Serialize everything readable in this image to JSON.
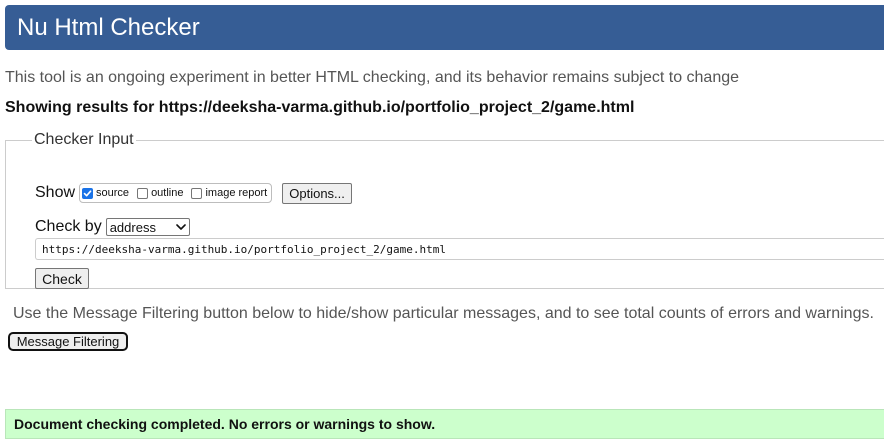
{
  "header": {
    "title": "Nu Html Checker"
  },
  "subtitle": "This tool is an ongoing experiment in better HTML checking, and its behavior remains subject to change",
  "results_heading": "Showing results for https://deeksha-varma.github.io/portfolio_project_2/game.html",
  "checker_input": {
    "legend": "Checker Input",
    "show_label": "Show",
    "show_options": [
      {
        "label": "source",
        "checked": true
      },
      {
        "label": "outline",
        "checked": false
      },
      {
        "label": "image report",
        "checked": false
      }
    ],
    "options_button": "Options...",
    "check_by_label": "Check by",
    "check_by_value": "address",
    "url_value": "https://deeksha-varma.github.io/portfolio_project_2/game.html",
    "check_button": "Check"
  },
  "filter_info": "Use the Message Filtering button below to hide/show particular messages, and to see total counts of errors and warnings.",
  "filter_button": "Message Filtering",
  "success_message": "Document checking completed. No errors or warnings to show.",
  "colors": {
    "header_bg": "#365d95",
    "success_bg": "#ccffcc",
    "checkbox_checked": "#1a73e8"
  }
}
